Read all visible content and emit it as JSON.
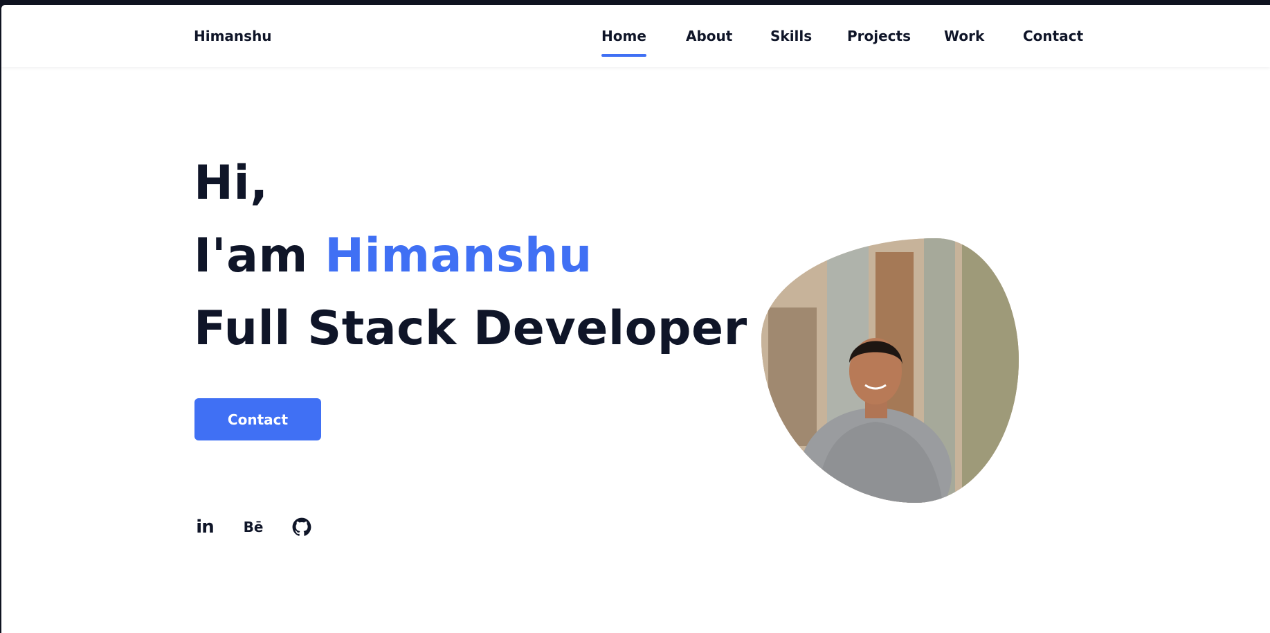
{
  "header": {
    "logo": "Himanshu",
    "nav": [
      {
        "label": "Home",
        "active": true
      },
      {
        "label": "About",
        "active": false
      },
      {
        "label": "Skills",
        "active": false
      },
      {
        "label": "Projects",
        "active": false
      },
      {
        "label": "Work",
        "active": false
      },
      {
        "label": "Contact",
        "active": false
      }
    ]
  },
  "hero": {
    "greeting": "Hi,",
    "intro_prefix": "I'am",
    "name": "Himanshu",
    "role": "Full Stack Developer",
    "cta_label": "Contact"
  },
  "social": [
    {
      "icon": "linkedin-icon",
      "text": "in"
    },
    {
      "icon": "behance-icon",
      "text": "Bē"
    },
    {
      "icon": "github-icon",
      "text": ""
    }
  ],
  "colors": {
    "accent": "#4070f4",
    "text": "#0f1528",
    "background": "#ffffff"
  }
}
